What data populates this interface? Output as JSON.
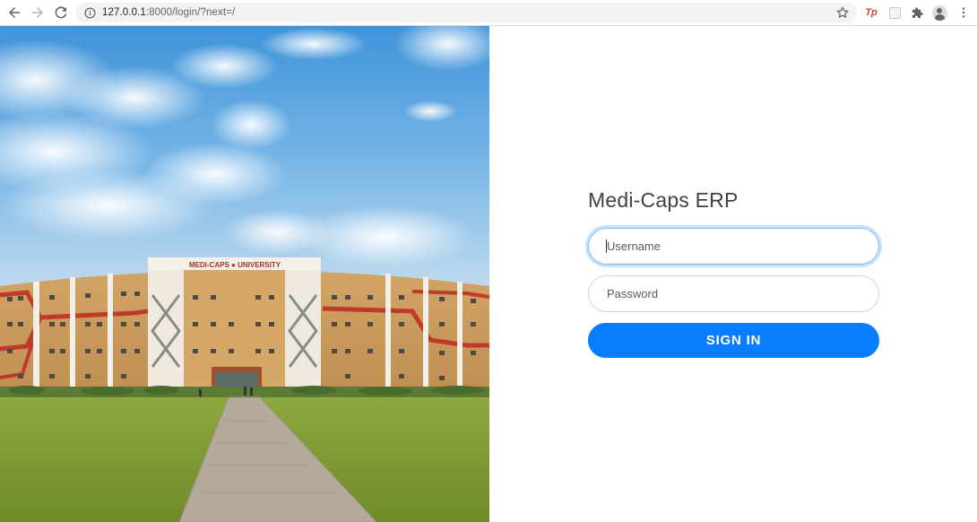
{
  "browser": {
    "url_host": "127.0.0.1",
    "url_rest": ":8000/login/?next=/",
    "icons": [
      "back-arrow-icon",
      "forward-arrow-icon",
      "reload-icon",
      "info-icon",
      "bookmark-star-icon",
      "tp-extension-icon",
      "blank-extension-icon",
      "extensions-puzzle-icon",
      "profile-avatar-icon",
      "kebab-menu-icon"
    ],
    "extension_tp_label": "Tp"
  },
  "hero": {
    "building_sign": "MEDI-CAPS ● UNIVERSITY"
  },
  "login": {
    "title": "Medi-Caps ERP",
    "username_placeholder": "Username",
    "password_placeholder": "Password",
    "signin_label": "SIGN IN"
  },
  "colors": {
    "accent": "#0a7cff",
    "focus_ring": "#80bdff",
    "title_text": "#3d4347"
  }
}
